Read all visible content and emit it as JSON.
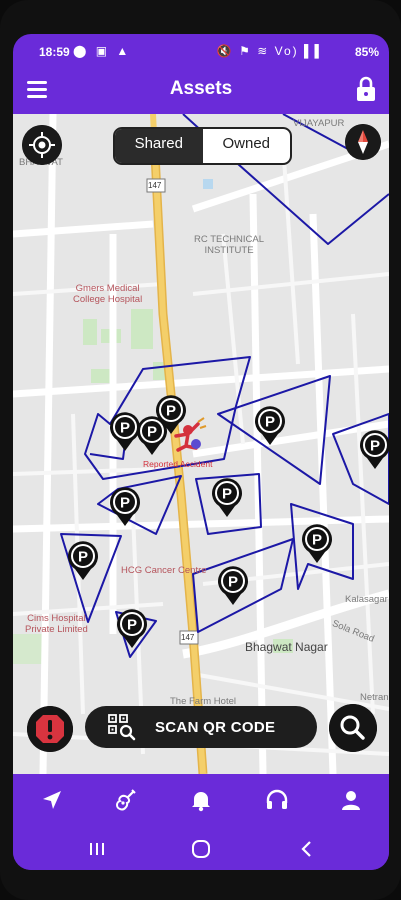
{
  "status_bar": {
    "time": "18:59",
    "left_icons": "⬤ ▣ ▲",
    "right_icons": "🔇 ⚑ ≋ Vo) ▌▌",
    "battery": "85%"
  },
  "app_bar": {
    "title": "Assets"
  },
  "map_controls": {
    "segment_shared": "Shared",
    "segment_owned": "Owned",
    "active_segment": "Shared"
  },
  "map_labels": {
    "bhagvat": "BHAGVAT",
    "vijayapur": "VIJAYAPUR",
    "rc_institute": "RC TECHNICAL\nINSTITUTE",
    "omers": "Gmers Medical\nCollege Hospital",
    "hcg": "HCG Cancer Centre",
    "cims": "Cims Hospital\nPrivate Limited",
    "bhagwat_nagar": "Bhagwat Nagar",
    "sola_road": "Sola Road",
    "kalasagar": "Kalasagar",
    "netrang": "Netran",
    "farm_hotel": "The Farm Hotel",
    "route_147_top": "147",
    "route_147_bottom": "147"
  },
  "incident": {
    "label": "Reported Accident"
  },
  "actions": {
    "scan_label": "SCAN QR CODE"
  },
  "bottom_tabs": [
    "navigate",
    "guitar",
    "notifications",
    "support",
    "profile"
  ],
  "colors": {
    "accent": "#6a2bd9",
    "polygon": "#1c18a6",
    "pin": "#111111",
    "accident": "#d4313d",
    "road_major": "#f2c75c"
  }
}
